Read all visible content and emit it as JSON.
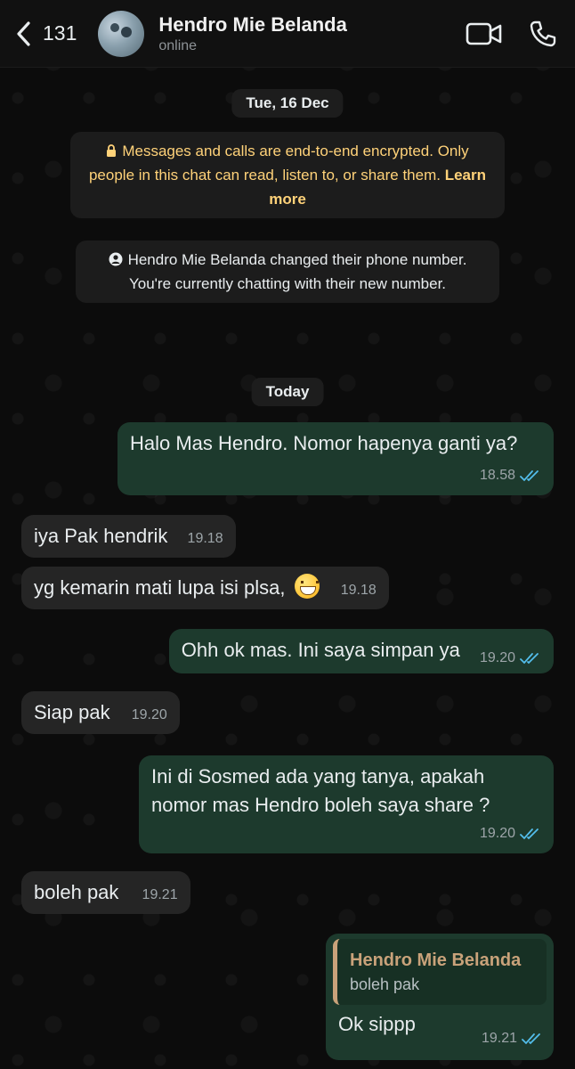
{
  "header": {
    "back_count": "131",
    "contact_name": "Hendro Mie Belanda",
    "status": "online"
  },
  "chat": {
    "date_1": "Tue, 16 Dec",
    "encryption_notice": "Messages and calls are end-to-end encrypted. Only people in this chat can read, listen to, or share them.",
    "encryption_link": "Learn more",
    "number_change_notice": "Hendro Mie Belanda changed their phone number. You're currently chatting with their new number.",
    "date_2": "Today",
    "messages": [
      {
        "direction": "out",
        "text": "Halo Mas Hendro. Nomor hapenya ganti ya?",
        "time": "18.58"
      },
      {
        "direction": "in",
        "text": "iya Pak hendrik",
        "time": "19.18"
      },
      {
        "direction": "in",
        "text": "yg kemarin mati lupa isi plsa,",
        "time": "19.18",
        "emoji": "grinning-face"
      },
      {
        "direction": "out",
        "text": "Ohh ok mas. Ini saya simpan ya",
        "time": "19.20"
      },
      {
        "direction": "in",
        "text": "Siap pak",
        "time": "19.20"
      },
      {
        "direction": "out",
        "text": "Ini di Sosmed ada yang tanya, apakah nomor mas Hendro boleh saya share ?",
        "time": "19.20"
      },
      {
        "direction": "in",
        "text": "boleh pak",
        "time": "19.21"
      },
      {
        "direction": "out",
        "quote_name": "Hendro Mie Belanda",
        "quote_text": "boleh pak",
        "text": "Ok sippp",
        "time": "19.21"
      }
    ]
  },
  "colors": {
    "incoming_bubble": "#252525",
    "outgoing_bubble": "#1d3a2d",
    "read_ticks": "#53bdeb",
    "encryption_text": "#ffd279",
    "quote_accent": "#c9a27a"
  }
}
